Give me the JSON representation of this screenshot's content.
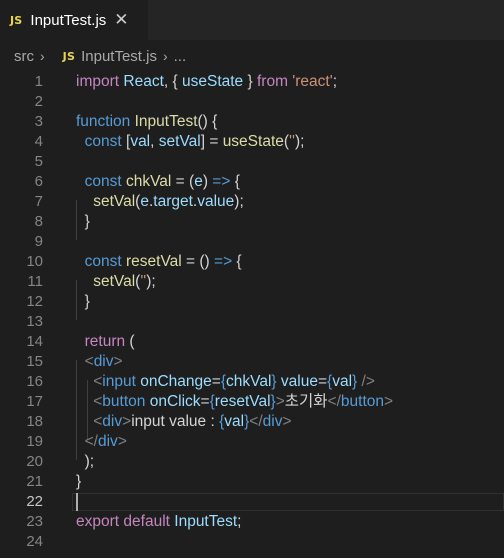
{
  "tab": {
    "badge": "JS",
    "label": "InputTest.js",
    "close": "✕"
  },
  "breadcrumb": {
    "folder": "src",
    "badge": "JS",
    "file": "InputTest.js",
    "more": "..."
  },
  "editor": {
    "active_line": 22,
    "lines": [
      {
        "n": "1",
        "tokens": [
          [
            "kc",
            "import"
          ],
          [
            "pn",
            " "
          ],
          [
            "vr",
            "React"
          ],
          [
            "pn",
            ", { "
          ],
          [
            "vr",
            "useState"
          ],
          [
            "pn",
            " } "
          ],
          [
            "kc",
            "from"
          ],
          [
            "pn",
            " "
          ],
          [
            "st",
            "'react'"
          ],
          [
            "pn",
            ";"
          ]
        ]
      },
      {
        "n": "2",
        "tokens": []
      },
      {
        "n": "3",
        "tokens": [
          [
            "kw",
            "function"
          ],
          [
            "pn",
            " "
          ],
          [
            "fn",
            "InputTest"
          ],
          [
            "pn",
            "() {"
          ]
        ]
      },
      {
        "n": "4",
        "tokens": [
          [
            "pn",
            "  "
          ],
          [
            "kw",
            "const"
          ],
          [
            "pn",
            " ["
          ],
          [
            "vr",
            "val"
          ],
          [
            "pn",
            ", "
          ],
          [
            "vr",
            "setVal"
          ],
          [
            "pn",
            "] = "
          ],
          [
            "fn",
            "useState"
          ],
          [
            "pn",
            "("
          ],
          [
            "st",
            "''"
          ],
          [
            "pn",
            ");"
          ]
        ]
      },
      {
        "n": "5",
        "tokens": []
      },
      {
        "n": "6",
        "tokens": [
          [
            "pn",
            "  "
          ],
          [
            "kw",
            "const"
          ],
          [
            "pn",
            " "
          ],
          [
            "fn",
            "chkVal"
          ],
          [
            "pn",
            " = ("
          ],
          [
            "vr",
            "e"
          ],
          [
            "pn",
            ") "
          ],
          [
            "kw",
            "=>"
          ],
          [
            "pn",
            " {"
          ]
        ]
      },
      {
        "n": "7",
        "tokens": [
          [
            "pn",
            "    "
          ],
          [
            "fn",
            "setVal"
          ],
          [
            "pn",
            "("
          ],
          [
            "vr",
            "e"
          ],
          [
            "pn",
            "."
          ],
          [
            "vr",
            "target"
          ],
          [
            "pn",
            "."
          ],
          [
            "vr",
            "value"
          ],
          [
            "pn",
            ");"
          ]
        ]
      },
      {
        "n": "8",
        "tokens": [
          [
            "pn",
            "  }"
          ]
        ]
      },
      {
        "n": "9",
        "tokens": []
      },
      {
        "n": "10",
        "tokens": [
          [
            "pn",
            "  "
          ],
          [
            "kw",
            "const"
          ],
          [
            "pn",
            " "
          ],
          [
            "fn",
            "resetVal"
          ],
          [
            "pn",
            " = () "
          ],
          [
            "kw",
            "=>"
          ],
          [
            "pn",
            " {"
          ]
        ]
      },
      {
        "n": "11",
        "tokens": [
          [
            "pn",
            "    "
          ],
          [
            "fn",
            "setVal"
          ],
          [
            "pn",
            "("
          ],
          [
            "st",
            "''"
          ],
          [
            "pn",
            ");"
          ]
        ]
      },
      {
        "n": "12",
        "tokens": [
          [
            "pn",
            "  }"
          ]
        ]
      },
      {
        "n": "13",
        "tokens": []
      },
      {
        "n": "14",
        "tokens": [
          [
            "pn",
            "  "
          ],
          [
            "kc",
            "return"
          ],
          [
            "pn",
            " ("
          ]
        ]
      },
      {
        "n": "15",
        "tokens": [
          [
            "pn",
            "  "
          ],
          [
            "tg",
            "<"
          ],
          [
            "tn",
            "div"
          ],
          [
            "tg",
            ">"
          ]
        ]
      },
      {
        "n": "16",
        "tokens": [
          [
            "pn",
            "    "
          ],
          [
            "tg",
            "<"
          ],
          [
            "tn",
            "input"
          ],
          [
            "pn",
            " "
          ],
          [
            "at",
            "onChange"
          ],
          [
            "pn",
            "="
          ],
          [
            "br",
            "{"
          ],
          [
            "vr",
            "chkVal"
          ],
          [
            "br",
            "}"
          ],
          [
            "pn",
            " "
          ],
          [
            "at",
            "value"
          ],
          [
            "pn",
            "="
          ],
          [
            "br",
            "{"
          ],
          [
            "vr",
            "val"
          ],
          [
            "br",
            "}"
          ],
          [
            "pn",
            " "
          ],
          [
            "tg",
            "/>"
          ]
        ]
      },
      {
        "n": "17",
        "tokens": [
          [
            "pn",
            "    "
          ],
          [
            "tg",
            "<"
          ],
          [
            "tn",
            "button"
          ],
          [
            "pn",
            " "
          ],
          [
            "at",
            "onClick"
          ],
          [
            "pn",
            "="
          ],
          [
            "br",
            "{"
          ],
          [
            "vr",
            "resetVal"
          ],
          [
            "br",
            "}"
          ],
          [
            "tg",
            ">"
          ],
          [
            "pn",
            "초기화"
          ],
          [
            "tg",
            "</"
          ],
          [
            "tn",
            "button"
          ],
          [
            "tg",
            ">"
          ]
        ]
      },
      {
        "n": "18",
        "tokens": [
          [
            "pn",
            "    "
          ],
          [
            "tg",
            "<"
          ],
          [
            "tn",
            "div"
          ],
          [
            "tg",
            ">"
          ],
          [
            "pn",
            "input value : "
          ],
          [
            "br",
            "{"
          ],
          [
            "vr",
            "val"
          ],
          [
            "br",
            "}"
          ],
          [
            "tg",
            "</"
          ],
          [
            "tn",
            "div"
          ],
          [
            "tg",
            ">"
          ]
        ]
      },
      {
        "n": "19",
        "tokens": [
          [
            "pn",
            "  "
          ],
          [
            "tg",
            "</"
          ],
          [
            "tn",
            "div"
          ],
          [
            "tg",
            ">"
          ]
        ]
      },
      {
        "n": "20",
        "tokens": [
          [
            "pn",
            "  );"
          ]
        ]
      },
      {
        "n": "21",
        "tokens": [
          [
            "pn",
            "}"
          ]
        ]
      },
      {
        "n": "22",
        "tokens": []
      },
      {
        "n": "23",
        "tokens": [
          [
            "kc",
            "export"
          ],
          [
            "pn",
            " "
          ],
          [
            "kc",
            "default"
          ],
          [
            "pn",
            " "
          ],
          [
            "vr",
            "InputTest"
          ],
          [
            "pn",
            ";"
          ]
        ]
      },
      {
        "n": "24",
        "tokens": []
      }
    ]
  }
}
